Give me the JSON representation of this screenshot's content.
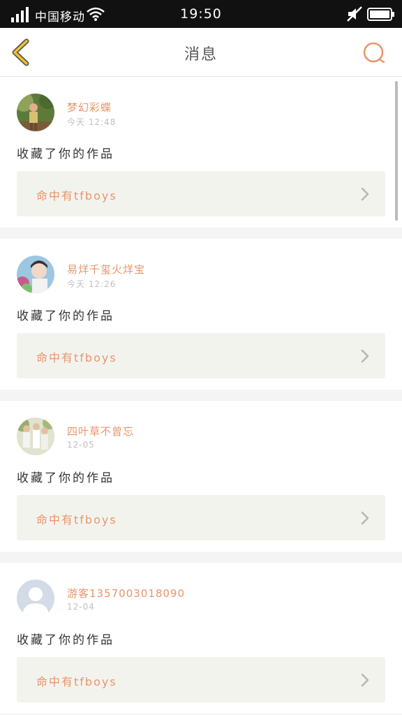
{
  "status_bar": {
    "carrier": "中国移动",
    "time": "19:50"
  },
  "header": {
    "title": "消息"
  },
  "messages": [
    {
      "username": "梦幻彩蝶",
      "time": "今天 12:48",
      "text": "收藏了你的作品",
      "work_title": "命中有tfboys"
    },
    {
      "username": "易烊千玺火烊宝",
      "time": "今天 12:26",
      "text": "收藏了你的作品",
      "work_title": "命中有tfboys"
    },
    {
      "username": "四叶草不曾忘",
      "time": "12-05",
      "text": "收藏了你的作品",
      "work_title": "命中有tfboys"
    },
    {
      "username": "游客1357003018090",
      "time": "12-04",
      "text": "收藏了你的作品",
      "work_title": "命中有tfboys"
    }
  ],
  "colors": {
    "accent": "#e8956a",
    "back_icon": "#f2c12e",
    "link_bg": "#f3f3ee"
  },
  "icons": [
    "signal-icon",
    "wifi-icon",
    "mute-icon",
    "battery-icon",
    "back-arrow-icon",
    "search-icon",
    "chevron-right-icon"
  ]
}
